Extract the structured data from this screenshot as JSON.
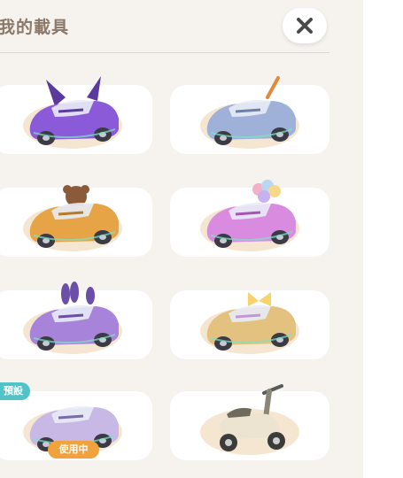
{
  "header": {
    "title": "我的載具",
    "close_icon": "close-icon"
  },
  "vehicles": [
    {
      "kind": "car",
      "body": "#8a5ad8",
      "accent": "#5b3aa0",
      "decor": "wings"
    },
    {
      "kind": "car",
      "body": "#9fb1d8",
      "accent": "#6d7fa8",
      "decor": "antenna"
    },
    {
      "kind": "car",
      "body": "#e7a447",
      "accent": "#b67a2a",
      "decor": "bear"
    },
    {
      "kind": "car",
      "body": "#d98be0",
      "accent": "#a655b3",
      "decor": "balloons"
    },
    {
      "kind": "car",
      "body": "#a783d9",
      "accent": "#6b4ea8",
      "decor": "bunny"
    },
    {
      "kind": "car",
      "body": "#e2c27e",
      "accent": "#c695d8",
      "decor": "bow"
    },
    {
      "kind": "car",
      "body": "#c8b8e6",
      "accent": "#7d6aa8",
      "decor": "pattern"
    },
    {
      "kind": "scooter",
      "body": "#ece4d0",
      "accent": "#8a8676",
      "decor": "none"
    }
  ],
  "badges": {
    "default_label": "預設",
    "in_use_label": "使用中"
  }
}
